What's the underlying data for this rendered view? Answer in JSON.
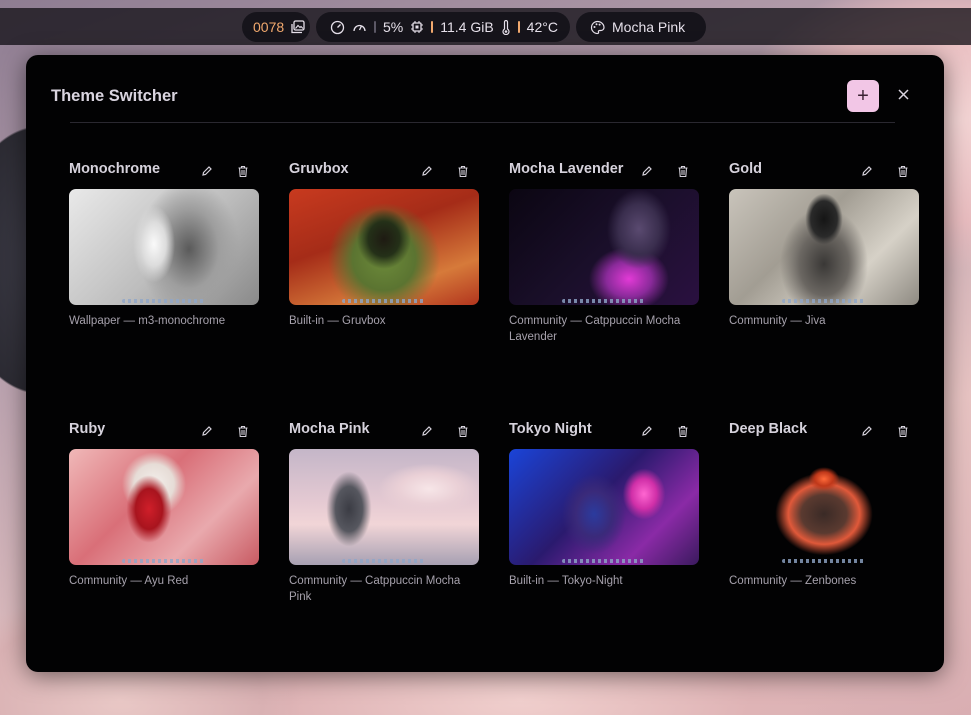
{
  "topbar": {
    "counter": "0078",
    "cpu": "5%",
    "memory": "11.4 GiB",
    "temperature": "42°C",
    "theme": "Mocha Pink",
    "icons": [
      "gallery-icon",
      "gauge-icon",
      "speedometer-icon",
      "chip-icon",
      "thermometer-icon",
      "palette-icon"
    ]
  },
  "dialog": {
    "title": "Theme Switcher",
    "add_label": "+",
    "close_label": "×"
  },
  "themes": [
    {
      "name": "Monochrome",
      "source": "Wallpaper — m3-monochrome",
      "accent": "#9a9a9a"
    },
    {
      "name": "Gruvbox",
      "source": "Built-in — Gruvbox",
      "accent": "#b5472b"
    },
    {
      "name": "Mocha Lavender",
      "source": "Community — Catppuccin Mocha Lavender",
      "accent": "#7b3fa0"
    },
    {
      "name": "Gold",
      "source": "Community — Jiva",
      "accent": "#8a8680"
    },
    {
      "name": "Ruby",
      "source": "Community — Ayu Red",
      "accent": "#d7585f"
    },
    {
      "name": "Mocha Pink",
      "source": "Community — Catppuccin Mocha Pink",
      "accent": "#d6b3c1"
    },
    {
      "name": "Tokyo Night",
      "source": "Built-in — Tokyo-Night",
      "accent": "#3a4fd6"
    },
    {
      "name": "Deep Black",
      "source": "Community — Zenbones",
      "accent": "#e0593a"
    }
  ]
}
